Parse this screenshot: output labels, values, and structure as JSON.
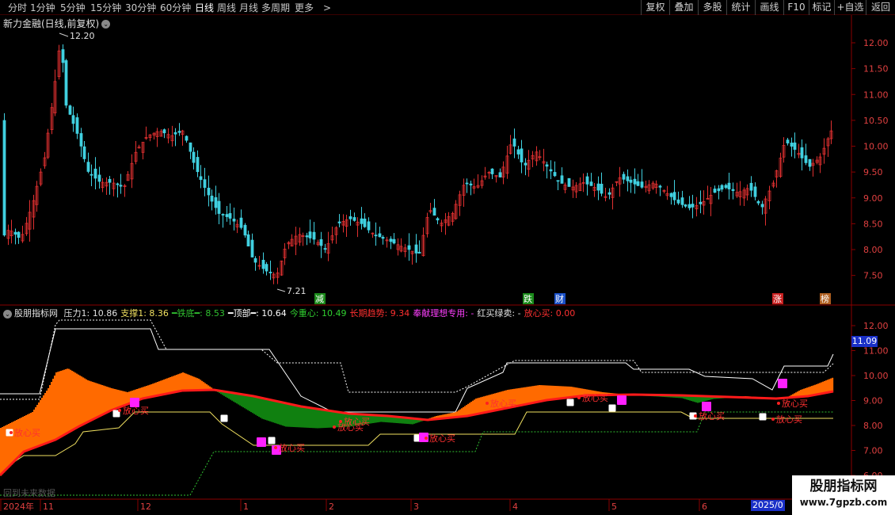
{
  "toolbar": {
    "periods": [
      "分时",
      "1分钟",
      "5分钟",
      "15分钟",
      "30分钟",
      "60分钟",
      "日线",
      "周线",
      "月线",
      "多周期",
      "更多"
    ],
    "active_period": "日线",
    "more_arrow": ">",
    "right_buttons": [
      "复权",
      "叠加",
      "多股",
      "统计",
      "画线",
      "F10",
      "标记",
      "+自选",
      "返回"
    ]
  },
  "stock": {
    "title": "新力金融(日线,前复权)",
    "high_label": "12.20",
    "low_label": "7.21"
  },
  "main_axis": {
    "labels": [
      "12.00",
      "11.50",
      "11.00",
      "10.50",
      "10.00",
      "9.50",
      "9.00",
      "8.50",
      "8.00",
      "7.50"
    ]
  },
  "badges": [
    {
      "text": "减",
      "color": "#1a8a1a"
    },
    {
      "text": "跌",
      "color": "#1a8a1a"
    },
    {
      "text": "财",
      "color": "#1a50c8"
    },
    {
      "text": "涨",
      "color": "#c82020"
    },
    {
      "text": "榜",
      "color": "#b06020"
    }
  ],
  "indicator": {
    "name": "股朋指标网",
    "items": [
      {
        "text": "压力1: 10.86",
        "color": "#e0e0e0"
      },
      {
        "text": "支撑1: 8.36",
        "color": "#f0e060"
      },
      {
        "text": "━铁底━: 8.53",
        "color": "#30c030"
      },
      {
        "text": "━顶部━: 10.64",
        "color": "#ffffff"
      },
      {
        "text": "今重心: 10.49",
        "color": "#30d030"
      },
      {
        "text": "长期趋势: 9.34",
        "color": "#ff3030"
      },
      {
        "text": "奉献理想专用: -",
        "color": "#ff40ff"
      },
      {
        "text": "红买绿卖: -",
        "color": "#e0e0e0"
      },
      {
        "text": "放心买: 0.00",
        "color": "#ff3030"
      }
    ],
    "axis_labels": [
      "12.00",
      "11.00",
      "10.00",
      "9.00",
      "8.00",
      "7.00",
      "6.00"
    ],
    "current_value": "11.09",
    "signal_text": "放心买",
    "footer_text": "回到未来数据"
  },
  "dates": {
    "labels": [
      "2024年",
      "11",
      "12",
      "1",
      "2",
      "3",
      "4",
      "5",
      "6",
      "2025/0"
    ],
    "current_box": "2025/0"
  },
  "watermark": {
    "line1": "股朋指标网",
    "line2": "www.7gpzb.com"
  },
  "colors": {
    "up": "#e03030",
    "down": "#40d0e0",
    "border": "#8a0000",
    "trend": "#ff1a1a",
    "band_up": "#ff6a00",
    "band_down": "#108010",
    "support": "#f0e060",
    "pressure": "#ffffff",
    "iron_bottom": "#30c030"
  }
}
